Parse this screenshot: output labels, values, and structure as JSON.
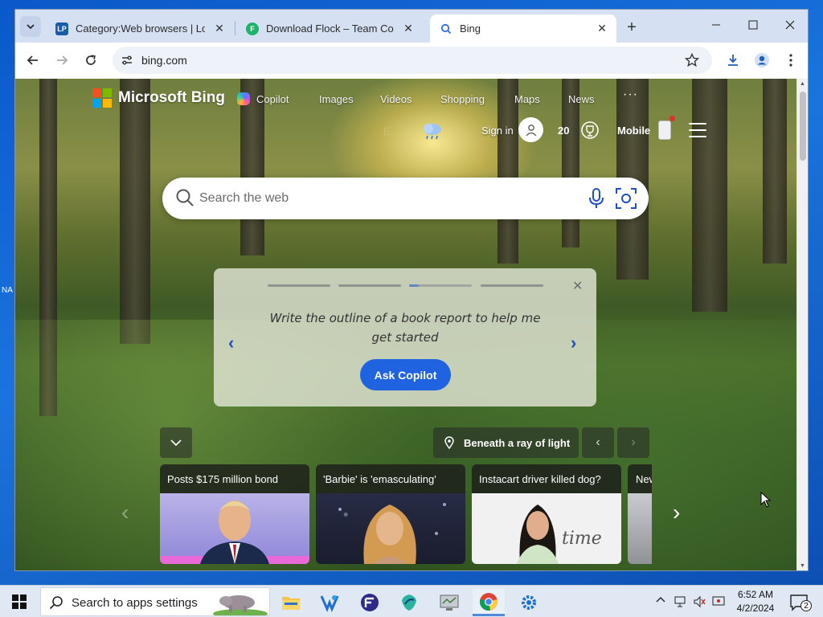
{
  "browser": {
    "tabs": [
      {
        "title": "Category:Web browsers | Logopedia",
        "favicon": "LP",
        "favicon_color": "#1a5ca8"
      },
      {
        "title": "Download Flock – Team Communication",
        "favicon": "F",
        "favicon_color": "#1fb36b"
      },
      {
        "title": "Bing",
        "favicon": "search-icon",
        "active": true
      }
    ],
    "address": "bing.com"
  },
  "bing": {
    "logo_text": "Microsoft Bing",
    "nav": [
      "Copilot",
      "Images",
      "Videos",
      "Shopping",
      "Maps",
      "News"
    ],
    "more": "···",
    "temp_fragment": "E",
    "sign_in": "Sign in",
    "points": "20",
    "mobile": "Mobile",
    "search_placeholder": "Search the web",
    "copilot_prompt": "Write the outline of a book report to help me get started",
    "ask_copilot": "Ask Copilot",
    "carousel": {
      "count": 4,
      "active": 3
    },
    "location_label": "Beneath a ray of light",
    "news": [
      {
        "headline": "Posts $175 million bond"
      },
      {
        "headline": "'Barbie' is 'emasculating'"
      },
      {
        "headline": "Instacart driver killed dog?"
      },
      {
        "headline": "New"
      }
    ],
    "news_thumb_text": "time"
  },
  "desktop": {
    "fragment": "NA"
  },
  "taskbar": {
    "search_text": "Search to apps settings",
    "time": "6:52 AM",
    "date": "4/2/2024",
    "notifications": "2"
  },
  "colors": {
    "accent": "#1f63e0",
    "taskbar": "#dfe8f3",
    "tabstrip": "#d5e0f3"
  }
}
